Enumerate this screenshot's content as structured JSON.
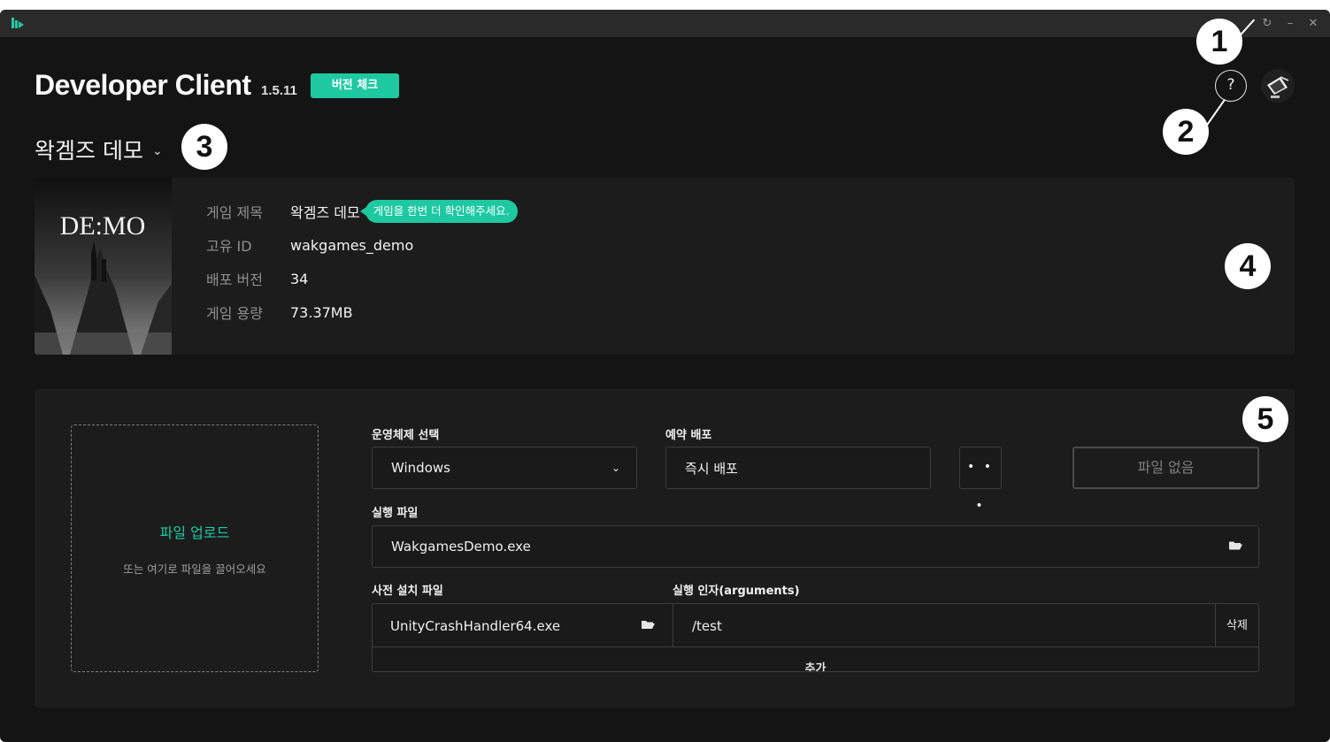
{
  "header": {
    "title": "Developer Client",
    "version": "1.5.11",
    "version_check_label": "버전 체크",
    "help_label": "?"
  },
  "titlebar": {
    "refresh_glyph": "↻",
    "minimize_glyph": "–",
    "close_glyph": "✕"
  },
  "callouts": [
    "1",
    "2",
    "3",
    "4",
    "5"
  ],
  "game_selector": {
    "selected": "왁겜즈 데모"
  },
  "game_info": {
    "cover_title": "DE:MO",
    "rows": [
      {
        "label": "게임 제목",
        "value": "왁겜즈 데모"
      },
      {
        "label": "고유 ID",
        "value": "wakgames_demo"
      },
      {
        "label": "배포 버전",
        "value": "34"
      },
      {
        "label": "게임 용량",
        "value": "73.37MB"
      }
    ],
    "warning": "게임을 한번 더 확인해주세요."
  },
  "upload": {
    "dropzone_title": "파일 업로드",
    "dropzone_subtitle": "또는 여기로 파일을 끌어오세요",
    "os_label": "운영체제 선택",
    "os_value": "Windows",
    "schedule_label": "예약 배포",
    "schedule_value": "즉시 배포",
    "more_label": "• • •",
    "nofile_label": "파일 없음",
    "exe_label": "실행 파일",
    "exe_value": "WakgamesDemo.exe",
    "preinstall_label": "사전 설치 파일",
    "args_label": "실행 인자(arguments)",
    "preinstall_file": "UnityCrashHandler64.exe",
    "args_value": "/test",
    "delete_label": "삭제",
    "add_label": "추가"
  },
  "colors": {
    "accent": "#1ec9a2",
    "window_bg": "#141414",
    "card_bg": "#1c1c1c",
    "titlebar_bg": "#2a2a2a"
  },
  "icons": [
    "app-logo-icon",
    "refresh-icon",
    "minimize-icon",
    "close-icon",
    "help-icon",
    "chevron-down-icon",
    "folder-open-icon"
  ]
}
